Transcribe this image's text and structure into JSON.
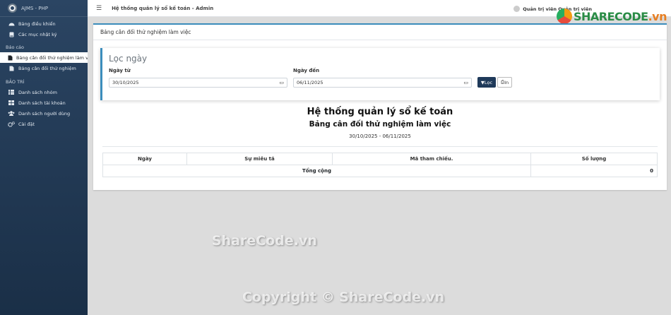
{
  "sidebar": {
    "brand": "AJMS - PHP",
    "items": [
      {
        "label": "Bảng điều khiển",
        "icon": "dashboard-icon"
      },
      {
        "label": "Các mục nhật ký",
        "icon": "book-icon"
      }
    ],
    "section_reports": "Báo cáo",
    "reports": [
      {
        "label": "Bảng cân đối thử nghiệm làm việc",
        "icon": "file-icon"
      },
      {
        "label": "Bảng cân đối thử nghiệm",
        "icon": "file-icon"
      }
    ],
    "section_maintenance": "BẢO TRÌ",
    "maintenance": [
      {
        "label": "Danh sách nhóm",
        "icon": "list-icon"
      },
      {
        "label": "Danh sách tài khoản",
        "icon": "table-icon"
      },
      {
        "label": "Danh sách người dùng",
        "icon": "users-icon"
      },
      {
        "label": "Cài đặt",
        "icon": "cogs-icon"
      }
    ]
  },
  "topbar": {
    "title": "Hệ thống quản lý sổ kế toán - Admin",
    "user": "Quản trị viên Quản trị viên"
  },
  "watermark_logo": {
    "main": "SHARECODE",
    "suffix": ".vn"
  },
  "card": {
    "header": "Bảng cân đối thử nghiệm làm việc",
    "filter": {
      "title": "Lọc ngày",
      "from_label": "Ngày từ",
      "from_value": "30/10/2025",
      "to_label": "Ngày đến",
      "to_value": "06/11/2025",
      "filter_btn": "Lọc",
      "print_btn": "In"
    },
    "report": {
      "title": "Hệ thống quản lý sổ kế toán",
      "subtitle": "Bảng cân đối thử nghiệm làm việc",
      "range": "30/10/2025 - 06/11/2025"
    },
    "table": {
      "headers": [
        "Ngày",
        "Sự miêu tả",
        "Mã tham chiếu.",
        "Số lượng"
      ],
      "total_label": "Tổng cộng",
      "total_value": "0"
    }
  },
  "watermarks": {
    "center": "ShareCode.vn",
    "bottom": "Copyright © ShareCode.vn"
  }
}
